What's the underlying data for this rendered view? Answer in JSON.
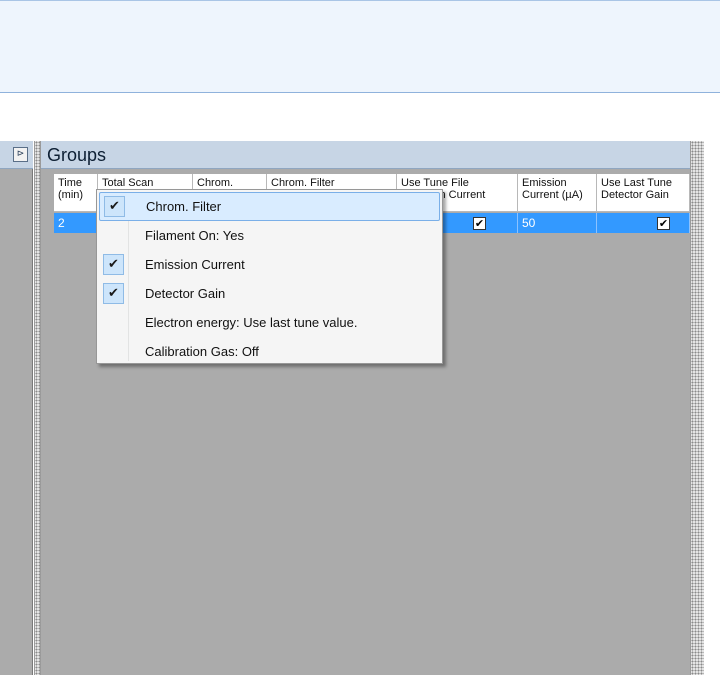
{
  "panel": {
    "collapse_glyph": "⊳",
    "title": "Groups"
  },
  "grid": {
    "columns": [
      "Time (min)",
      "Total Scan",
      "Chrom.",
      "Chrom. Filter",
      "Use Tune File Emission Current",
      "Emission Current (µA)",
      "Use Last Tune Detector Gain"
    ],
    "rows": [
      {
        "time": "2",
        "total_scan": "",
        "chrom": "",
        "chrom_filter": "",
        "use_tune_emission": true,
        "emission_current": "50",
        "use_last_detector_gain": true
      }
    ]
  },
  "context_menu": {
    "check_glyph": "✔",
    "items": [
      {
        "label": "Chrom. Filter",
        "checked": true,
        "highlighted": true
      },
      {
        "label": "Filament On: Yes",
        "checked": false
      },
      {
        "label": "Emission Current",
        "checked": true
      },
      {
        "label": "Detector Gain",
        "checked": true
      },
      {
        "label": "Electron energy: Use last tune value.",
        "checked": false
      },
      {
        "label": "Calibration Gas: Off",
        "checked": false
      }
    ]
  },
  "colors": {
    "selection": "#3399ff",
    "panel_header": "#c7d5e5",
    "workspace": "#ababab"
  }
}
